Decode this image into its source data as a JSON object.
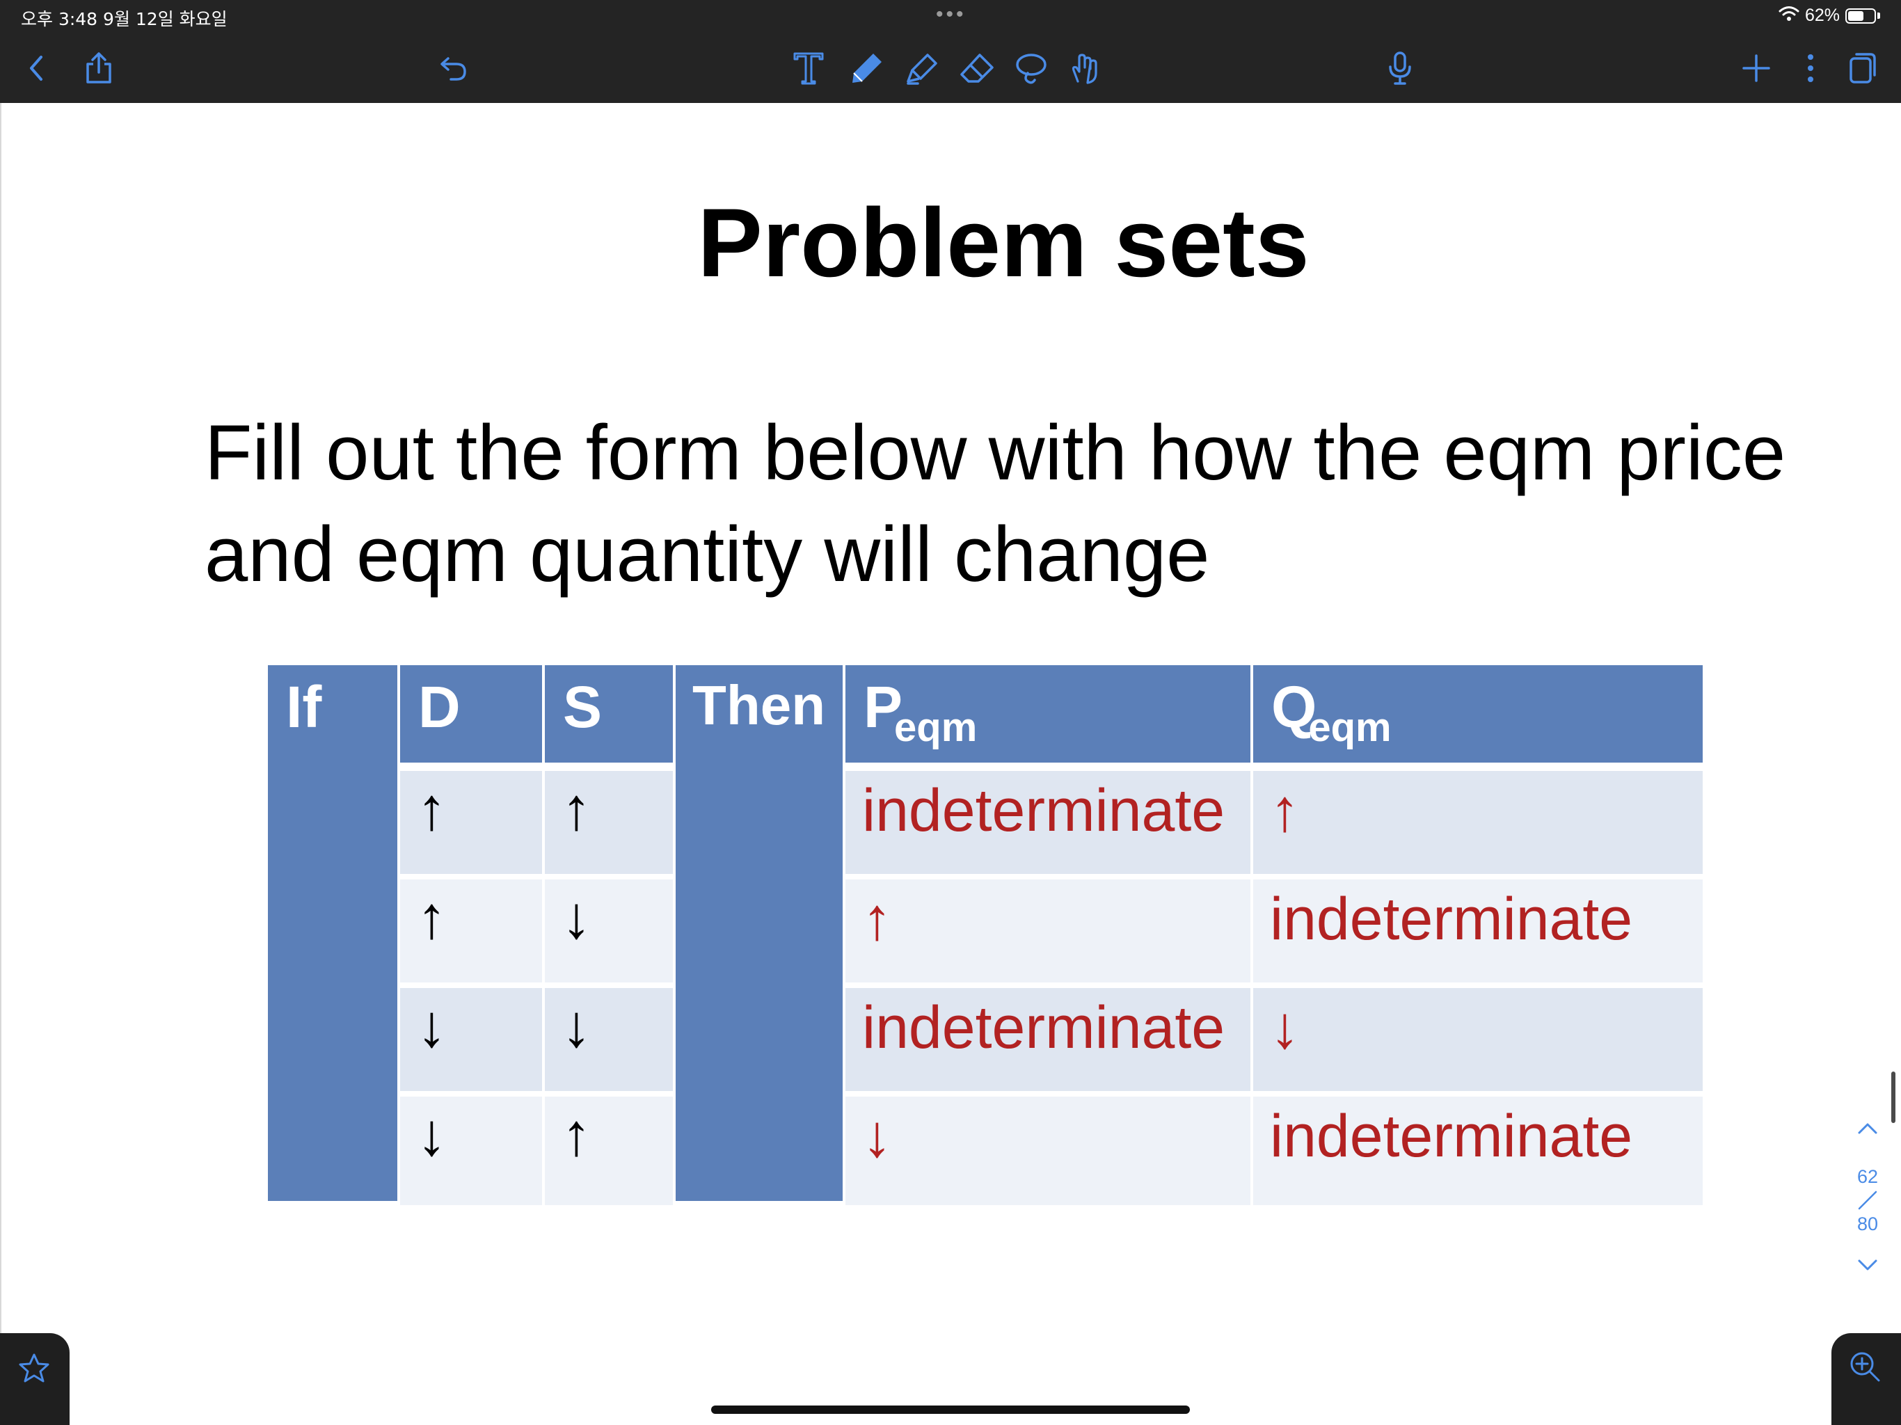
{
  "status_bar": {
    "time_date": "오후 3:48   9월 12일 화요일",
    "battery_text": "62%",
    "battery_level": 0.62,
    "multitask_dots": "•••"
  },
  "toolbar": {
    "left_icons": [
      "back-chevron-icon",
      "share-icon",
      "undo-icon"
    ],
    "tool_icons": [
      "text-tool-icon",
      "pen-tool-icon",
      "highlighter-tool-icon",
      "eraser-tool-icon",
      "lasso-tool-icon",
      "hand-gesture-icon"
    ],
    "center_icon": "microphone-icon",
    "right_icons": [
      "add-icon",
      "more-vertical-icon",
      "pages-icon"
    ],
    "icon_color": "#4a8be6"
  },
  "slide": {
    "title": "Problem sets",
    "body_line1": "Fill out the form below with how the eqm price",
    "body_line2": "and eqm quantity will change"
  },
  "table": {
    "header_color": "#5b7fb8",
    "answer_color": "#b22222",
    "headers": {
      "if": "If",
      "d": "D",
      "s": "S",
      "then": "Then",
      "p_main": "P",
      "p_sub": "eqm",
      "q_main": "Q",
      "q_sub": "eqm"
    },
    "rows": [
      {
        "d": "↑",
        "s": "↑",
        "p": "indeterminate",
        "q": "↑"
      },
      {
        "d": "↑",
        "s": "↓",
        "p": "↑",
        "q": "indeterminate"
      },
      {
        "d": "↓",
        "s": "↓",
        "p": "indeterminate",
        "q": "↓"
      },
      {
        "d": "↓",
        "s": "↑",
        "p": "↓",
        "q": "indeterminate"
      }
    ]
  },
  "navigator": {
    "current_page": "62",
    "total_pages": "80"
  },
  "bottom": {
    "favorite_icon": "star-icon",
    "zoom_icon": "zoom-in-icon"
  }
}
